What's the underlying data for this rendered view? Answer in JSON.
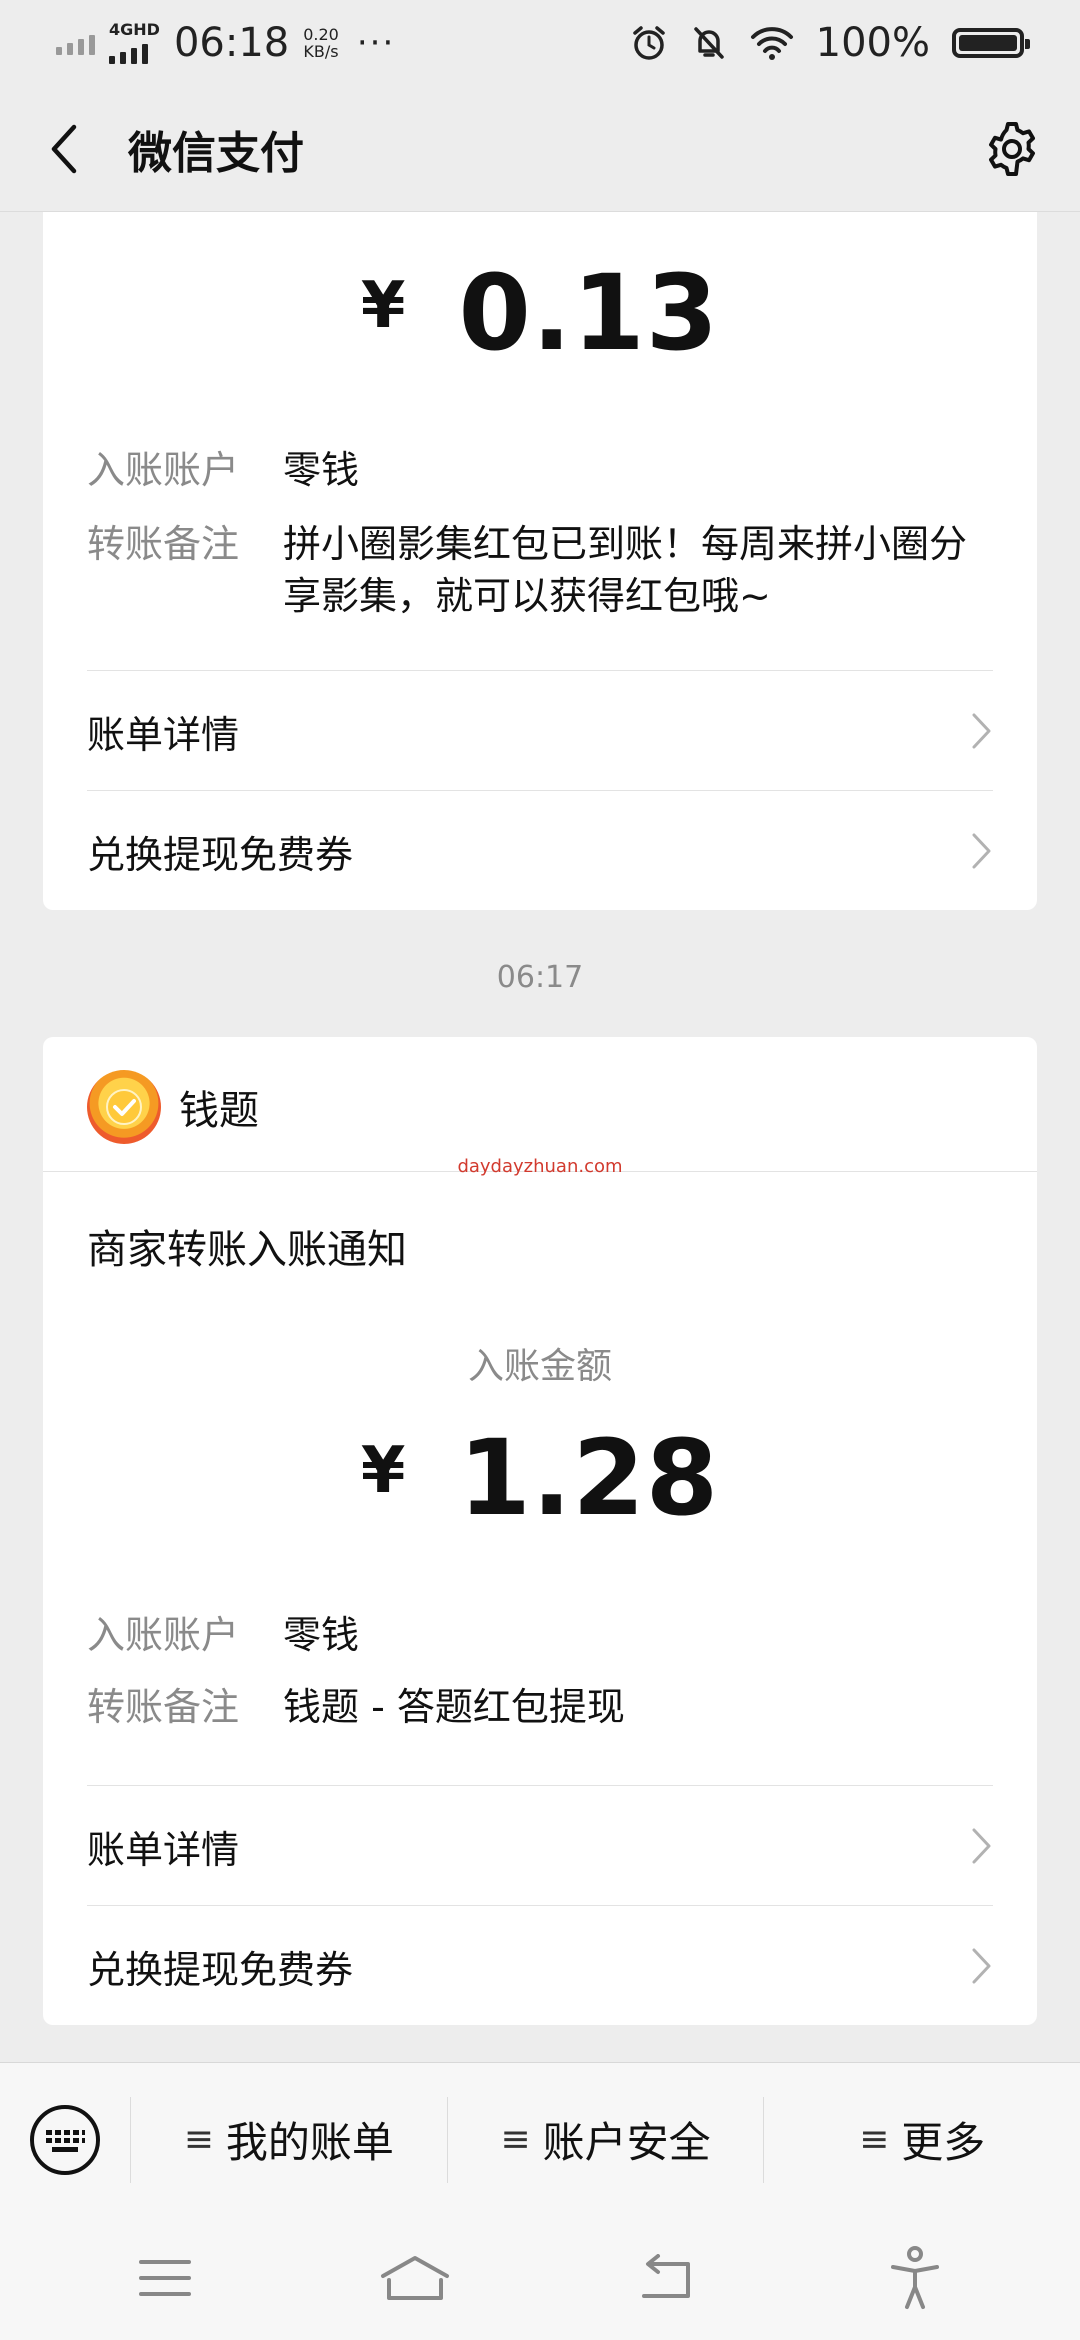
{
  "status_bar": {
    "network": "4GHD",
    "time": "06:18",
    "speed_value": "0.20",
    "speed_unit": "KB/s",
    "more": "···",
    "battery": "100%"
  },
  "header": {
    "title": "微信支付",
    "back_icon": "chevron-left-icon",
    "settings_icon": "gear-icon"
  },
  "card1": {
    "currency": "¥",
    "amount": "0.13",
    "account_label": "入账账户",
    "account_value": "零钱",
    "remark_label": "转账备注",
    "remark_value": "拼小圈影集红包已到账！每周来拼小圈分享影集，就可以获得红包哦~",
    "links": [
      "账单详情",
      "兑换提现免费券"
    ]
  },
  "time_separator": "06:17",
  "card2": {
    "merchant": "钱题",
    "watermark": "daydayzhuan.com",
    "notice_title": "商家转账入账通知",
    "amount_label": "入账金额",
    "currency": "¥",
    "amount": "1.28",
    "account_label": "入账账户",
    "account_value": "零钱",
    "remark_label": "转账备注",
    "remark_value": "钱题 - 答题红包提现",
    "links": [
      "账单详情",
      "兑换提现免费券"
    ]
  },
  "bottom_menu": {
    "items": [
      "我的账单",
      "账户安全",
      "更多"
    ],
    "keyboard_icon": "keyboard-icon"
  },
  "colors": {
    "background": "#ededed",
    "card": "#ffffff",
    "label_gray": "#8a8a8a",
    "watermark_red": "#d23a2e"
  }
}
